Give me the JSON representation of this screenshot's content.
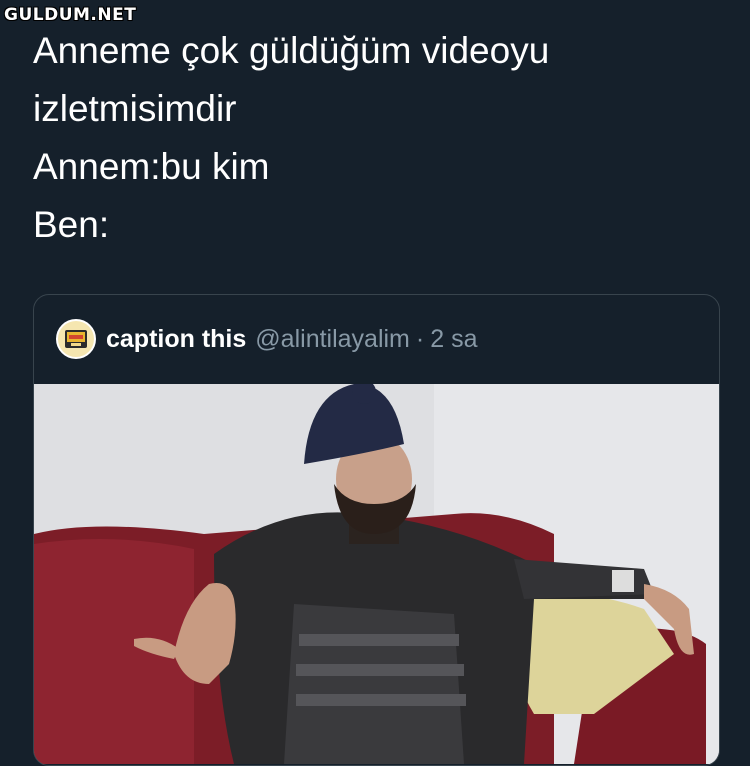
{
  "watermark": "GULDUM.NET",
  "tweet": {
    "lines": [
      "Anneme çok güldüğüm videoyu",
      "izletmisimdir",
      "Annem:bu kim",
      "Ben:"
    ]
  },
  "quoted_tweet": {
    "display_name": "caption this",
    "handle": "@alintilayalim",
    "separator": "·",
    "time": "2 sa"
  },
  "colors": {
    "background": "#15202b",
    "text": "#ffffff",
    "muted": "#8899a6",
    "border": "#38444d"
  }
}
